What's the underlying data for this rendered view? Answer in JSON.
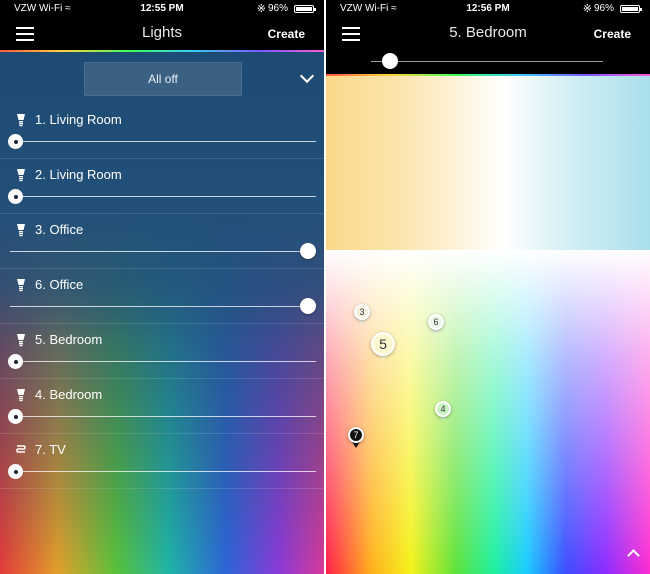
{
  "left_phone": {
    "status": {
      "carrier": "VZW Wi-Fi",
      "time": "12:55 PM",
      "battery": "96%"
    },
    "nav": {
      "title": "Lights",
      "create_label": "Create"
    },
    "all_off_label": "All off",
    "lights": [
      {
        "name": "1. Living Room",
        "icon": "bulb-icon",
        "brightness": 0
      },
      {
        "name": "2. Living Room",
        "icon": "bulb-icon",
        "brightness": 0
      },
      {
        "name": "3. Office",
        "icon": "bulb-icon",
        "brightness": 1
      },
      {
        "name": "6. Office",
        "icon": "bulb-icon",
        "brightness": 1
      },
      {
        "name": "5. Bedroom",
        "icon": "bulb-icon",
        "brightness": 0
      },
      {
        "name": "4. Bedroom",
        "icon": "bulb-icon",
        "brightness": 0
      },
      {
        "name": "7. TV",
        "icon": "lightstrip-icon",
        "brightness": 0
      }
    ]
  },
  "right_phone": {
    "status": {
      "carrier": "VZW Wi-Fi",
      "time": "12:56 PM",
      "battery": "96%"
    },
    "nav": {
      "title": "5. Bedroom",
      "create_label": "Create"
    },
    "brightness": 0.06,
    "pins": [
      {
        "label": "3",
        "size": "small",
        "color": "#f4f1e0"
      },
      {
        "label": "6",
        "size": "small",
        "color": "#e9f6e6"
      },
      {
        "label": "5",
        "size": "large",
        "color": "#fbf8cf"
      },
      {
        "label": "4",
        "size": "small",
        "color": "#c8f3c0"
      },
      {
        "label": "7",
        "size": "small",
        "color": "#111111"
      }
    ]
  }
}
